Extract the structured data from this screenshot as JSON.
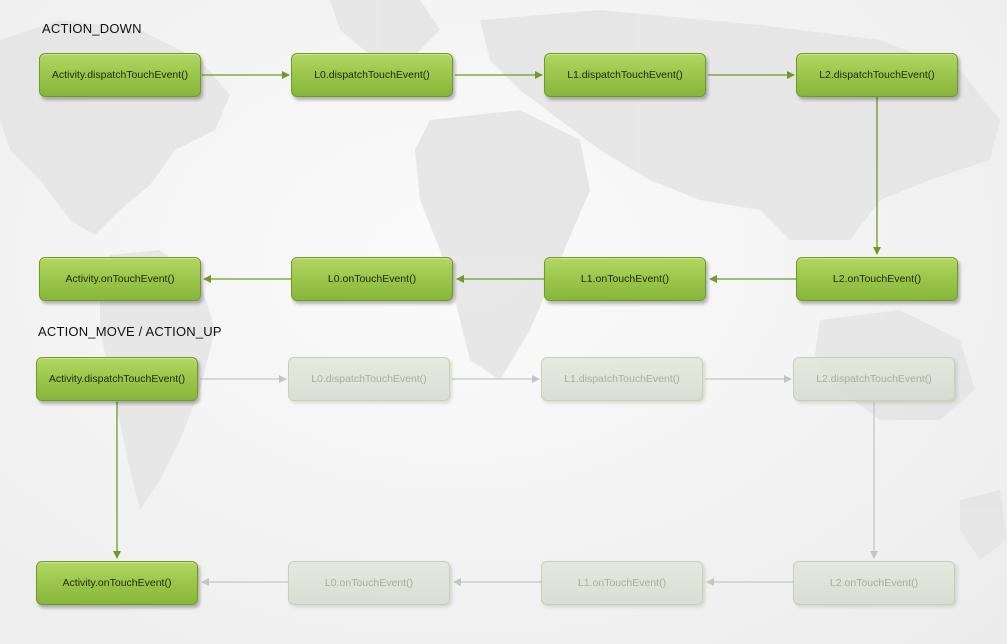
{
  "sections": {
    "down_title": "ACTION_DOWN",
    "move_up_title": "ACTION_MOVE / ACTION_UP"
  },
  "down": {
    "row1": [
      "Activity.dispatchTouchEvent()",
      "L0.dispatchTouchEvent()",
      "L1.dispatchTouchEvent()",
      "L2.dispatchTouchEvent()"
    ],
    "row2": [
      "Activity.onTouchEvent()",
      "L0.onTouchEvent()",
      "L1.onTouchEvent()",
      "L2.onTouchEvent()"
    ]
  },
  "move_up": {
    "row1": [
      "Activity.dispatchTouchEvent()",
      "L0.dispatchTouchEvent()",
      "L1.dispatchTouchEvent()",
      "L2.dispatchTouchEvent()"
    ],
    "row2": [
      "Activity.onTouchEvent()",
      "L0.onTouchEvent()",
      "L1.onTouchEvent()",
      "L2.onTouchEvent()"
    ]
  },
  "colors": {
    "active_fill": "#98c449",
    "active_border": "#6f9a2a",
    "active_arrow": "#6f9a2a",
    "inactive_fill": "#d9ddd0",
    "inactive_arrow": "#c4c7bf"
  }
}
